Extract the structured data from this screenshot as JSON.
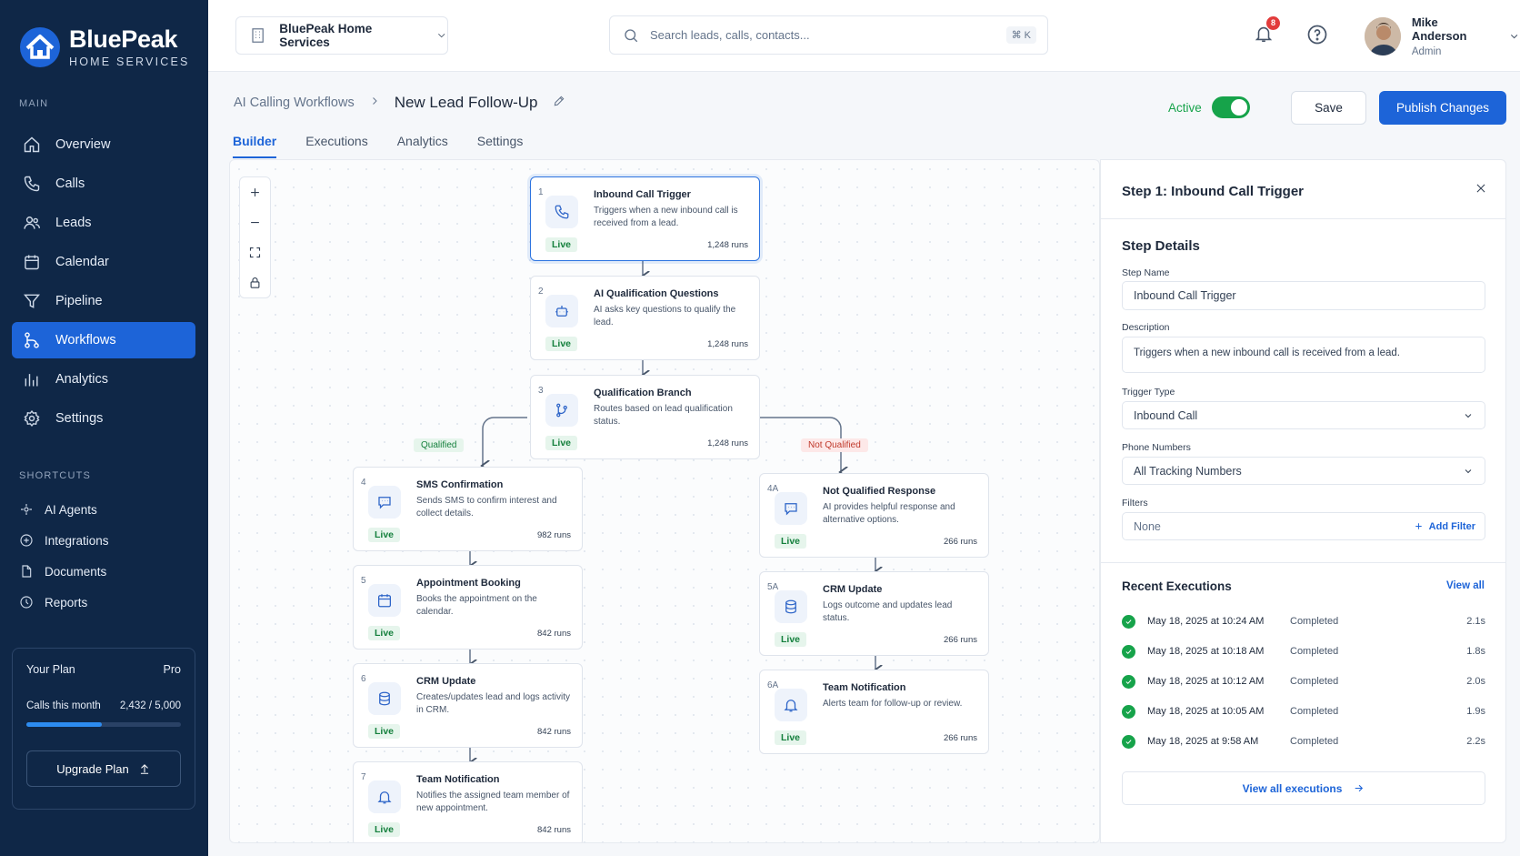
{
  "brand": {
    "name": "BluePeak",
    "tagline": "HOME SERVICES"
  },
  "sidebar": {
    "main_label": "MAIN",
    "items": [
      {
        "label": "Overview",
        "icon": "home-icon"
      },
      {
        "label": "Calls",
        "icon": "phone-icon"
      },
      {
        "label": "Leads",
        "icon": "users-icon"
      },
      {
        "label": "Calendar",
        "icon": "calendar-icon"
      },
      {
        "label": "Pipeline",
        "icon": "funnel-icon"
      },
      {
        "label": "Workflows",
        "icon": "workflow-icon",
        "active": true
      },
      {
        "label": "Analytics",
        "icon": "bar-chart-icon"
      },
      {
        "label": "Settings",
        "icon": "gear-icon"
      }
    ],
    "shortcuts_label": "SHORTCUTS",
    "shortcuts": [
      {
        "label": "AI Agents",
        "icon": "agents-icon"
      },
      {
        "label": "Integrations",
        "icon": "integrations-icon"
      },
      {
        "label": "Documents",
        "icon": "document-icon"
      },
      {
        "label": "Reports",
        "icon": "reports-icon"
      }
    ],
    "plan": {
      "label": "Your Plan",
      "tier": "Pro",
      "usage_label": "Calls this month",
      "usage_value": "2,432 / 5,000",
      "usage_fraction": 0.4864,
      "upgrade_label": "Upgrade Plan"
    }
  },
  "topbar": {
    "company": "BluePeak Home Services",
    "search_placeholder": "Search leads, calls, contacts...",
    "search_shortcut": "⌘ K",
    "notifications_count": "8",
    "user": {
      "name": "Mike Anderson",
      "role": "Admin"
    }
  },
  "header": {
    "breadcrumb_parent": "AI Calling Workflows",
    "title": "New Lead Follow-Up",
    "status_label": "Active",
    "status_on": true,
    "save_label": "Save",
    "publish_label": "Publish Changes",
    "tabs": [
      "Builder",
      "Executions",
      "Analytics",
      "Settings"
    ],
    "active_tab": "Builder"
  },
  "workflow": {
    "nodes": [
      {
        "num": "1",
        "title": "Inbound Call Trigger",
        "desc": "Triggers when a new inbound call is received from a lead.",
        "status": "Live",
        "runs": "1,248 runs",
        "icon": "phone-icon"
      },
      {
        "num": "2",
        "title": "AI Qualification Questions",
        "desc": "AI asks key questions to qualify the lead.",
        "status": "Live",
        "runs": "1,248 runs",
        "icon": "robot-icon"
      },
      {
        "num": "3",
        "title": "Qualification Branch",
        "desc": "Routes based on lead qualification status.",
        "status": "Live",
        "runs": "1,248 runs",
        "icon": "branch-icon"
      },
      {
        "num": "4",
        "title": "SMS Confirmation",
        "desc": "Sends SMS to confirm interest and collect details.",
        "status": "Live",
        "runs": "982 runs",
        "icon": "message-icon"
      },
      {
        "num": "5",
        "title": "Appointment Booking",
        "desc": "Books the appointment on the calendar.",
        "status": "Live",
        "runs": "842 runs",
        "icon": "calendar-icon"
      },
      {
        "num": "6",
        "title": "CRM Update",
        "desc": "Creates/updates lead and logs activity in CRM.",
        "status": "Live",
        "runs": "842 runs",
        "icon": "database-icon"
      },
      {
        "num": "7",
        "title": "Team Notification",
        "desc": "Notifies the assigned team member of new appointment.",
        "status": "Live",
        "runs": "842 runs",
        "icon": "bell-icon"
      },
      {
        "num": "4A",
        "title": "Not Qualified Response",
        "desc": "AI provides helpful response and alternative options.",
        "status": "Live",
        "runs": "266 runs",
        "icon": "message-icon"
      },
      {
        "num": "5A",
        "title": "CRM Update",
        "desc": "Logs outcome and updates lead status.",
        "status": "Live",
        "runs": "266 runs",
        "icon": "database-icon"
      },
      {
        "num": "6A",
        "title": "Team Notification",
        "desc": "Alerts team for follow-up or review.",
        "status": "Live",
        "runs": "266 runs",
        "icon": "bell-icon"
      }
    ],
    "branch_qualified": "Qualified",
    "branch_not_qualified": "Not Qualified"
  },
  "panel": {
    "title": "Step 1: Inbound Call Trigger",
    "details_title": "Step Details",
    "step_name_label": "Step Name",
    "step_name": "Inbound Call Trigger",
    "description_label": "Description",
    "description": "Triggers when a new inbound call is received from a lead.",
    "trigger_type_label": "Trigger Type",
    "trigger_type": "Inbound Call",
    "phone_numbers_label": "Phone Numbers",
    "phone_numbers": "All Tracking Numbers",
    "filters_label": "Filters",
    "filters_value": "None",
    "add_filter_label": "Add Filter",
    "recent_title": "Recent Executions",
    "view_all_label": "View all",
    "executions": [
      {
        "time": "May 18, 2025 at 10:24 AM",
        "status": "Completed",
        "duration": "2.1s"
      },
      {
        "time": "May 18, 2025 at 10:18 AM",
        "status": "Completed",
        "duration": "1.8s"
      },
      {
        "time": "May 18, 2025 at 10:12 AM",
        "status": "Completed",
        "duration": "2.0s"
      },
      {
        "time": "May 18, 2025 at 10:05 AM",
        "status": "Completed",
        "duration": "1.9s"
      },
      {
        "time": "May 18, 2025 at 9:58 AM",
        "status": "Completed",
        "duration": "2.2s"
      }
    ],
    "view_all_executions_label": "View all executions"
  },
  "colors": {
    "sidebar_bg": "#0f2747",
    "accent": "#1d64d8",
    "success": "#16a34a",
    "danger": "#c0392b"
  }
}
